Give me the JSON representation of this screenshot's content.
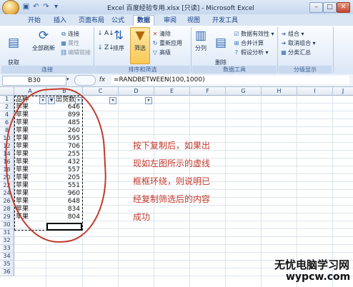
{
  "window": {
    "title": "Excel 百度经验专用.xlsx [只读] - Microsoft Excel",
    "minimize": "–",
    "maximize": "□",
    "close": "✕"
  },
  "tabs": [
    "开始",
    "插入",
    "页面布局",
    "公式",
    "数据",
    "审阅",
    "视图",
    "开发工具"
  ],
  "ribbon": {
    "groups": {
      "connections": "连接",
      "sort_filter": "排序和筛选",
      "data_tools": "数据工具",
      "outline": "分级显示"
    },
    "get_external": "获取\n外部数据",
    "refresh_all": "全部刷新",
    "connections_btn": "连接",
    "properties": "属性",
    "edit_links": "编辑链接",
    "sort": "排序",
    "filter": "筛选",
    "clear": "清除",
    "reapply": "重新应用",
    "advanced": "高级",
    "text_to_columns": "分列",
    "remove_dup": "删除\n重复项",
    "validation": "数据有效性",
    "consolidate": "合并计算",
    "whatif": "假设分析",
    "group": "组合",
    "ungroup": "取消组合",
    "subtotal": "分类汇总"
  },
  "formula_bar": {
    "name_box": "B30",
    "fx": "fx",
    "formula": "=RANDBETWEEN(100,1000)"
  },
  "columns": [
    "A",
    "B",
    "C",
    "D",
    "E",
    "F",
    "G",
    "H",
    "I",
    "J"
  ],
  "rows": [
    "1",
    "2",
    "4",
    "6",
    "8",
    "10",
    "12",
    "14",
    "16",
    "18",
    "20",
    "22",
    "24",
    "26",
    "28",
    "29",
    "30",
    "31",
    "32",
    "33",
    "34",
    "35",
    "36"
  ],
  "headers": {
    "a1": "品种",
    "b1": "出货数"
  },
  "data_rows": [
    {
      "name": "苹果",
      "value": "646"
    },
    {
      "name": "苹果",
      "value": "899"
    },
    {
      "name": "苹果",
      "value": "485"
    },
    {
      "name": "苹果",
      "value": "260"
    },
    {
      "name": "苹果",
      "value": "595"
    },
    {
      "name": "苹果",
      "value": "706"
    },
    {
      "name": "苹果",
      "value": "255"
    },
    {
      "name": "苹果",
      "value": "432"
    },
    {
      "name": "苹果",
      "value": "557"
    },
    {
      "name": "苹果",
      "value": "205"
    },
    {
      "name": "苹果",
      "value": "551"
    },
    {
      "name": "苹果",
      "value": "960"
    },
    {
      "name": "苹果",
      "value": "648"
    },
    {
      "name": "苹果",
      "value": "834"
    },
    {
      "name": "苹果",
      "value": "804"
    }
  ],
  "annotation": [
    "按下复制后，如果出",
    "现如左图所示的虚线",
    "框框环绕，则说明已",
    "经复制筛选后的内容",
    "成功"
  ],
  "watermark": {
    "line1": "无忧电脑学习网",
    "line2": "wypcw.com"
  },
  "colors": {
    "accent": "#c0392b",
    "ribbon": "#dbe6f4"
  }
}
